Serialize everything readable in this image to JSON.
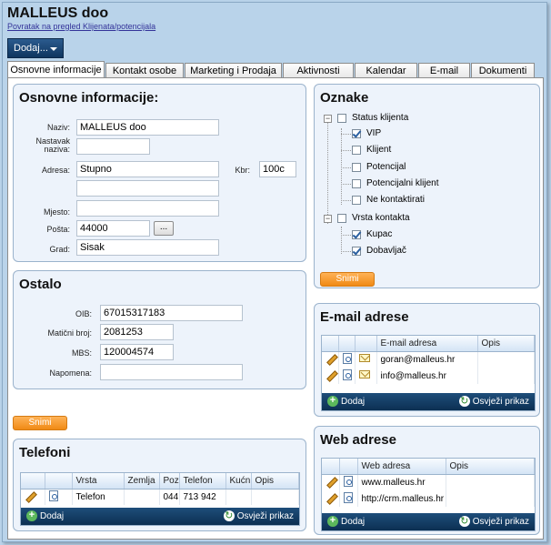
{
  "app": {
    "title": "MALLEUS doo",
    "back_link": "Povratak na pregled Klijenata/potencijala",
    "add_button": "Dodaj..."
  },
  "tabs": [
    {
      "label": "Osnovne informacije",
      "active": true
    },
    {
      "label": "Kontakt osobe"
    },
    {
      "label": "Marketing i Prodaja"
    },
    {
      "label": "Aktivnosti"
    },
    {
      "label": "Kalendar"
    },
    {
      "label": "E-mail"
    },
    {
      "label": "Dokumenti"
    }
  ],
  "basic_info": {
    "title": "Osnovne informacije:",
    "naziv_label": "Naziv:",
    "naziv_value": "MALLEUS doo",
    "nastavak_label": "Nastavak naziva:",
    "nastavak_value": "",
    "adresa_label": "Adresa:",
    "adresa_value": "Stupno",
    "adresa2_value": "",
    "kbr_label": "Kbr:",
    "kbr_value": "100c",
    "mjesto_label": "Mjesto:",
    "mjesto_value": "",
    "posta_label": "Pošta:",
    "posta_value": "44000",
    "posta_button": "...",
    "grad_label": "Grad:",
    "grad_value": "Sisak"
  },
  "other": {
    "title": "Ostalo",
    "oib_label": "OIB:",
    "oib_value": "67015317183",
    "mb_label": "Matični broj:",
    "mb_value": "2081253",
    "mbs_label": "MBS:",
    "mbs_value": "120004574",
    "napomena_label": "Napomena:",
    "napomena_value": "",
    "save_button": "Snimi"
  },
  "phones": {
    "title": "Telefoni",
    "columns": [
      "Vrsta",
      "Zemlja",
      "Poz",
      "Telefon",
      "Kućn",
      "Opis"
    ],
    "rows": [
      {
        "vrsta": "Telefon",
        "zemlja": "",
        "poz": "044",
        "telefon": "713 942",
        "kucni": "",
        "opis": ""
      }
    ],
    "add_label": "Dodaj",
    "refresh_label": "Osvježi prikaz"
  },
  "tags": {
    "title": "Oznake",
    "group1": "Status klijenta",
    "group1_items": [
      {
        "label": "VIP",
        "checked": true
      },
      {
        "label": "Klijent",
        "checked": false
      },
      {
        "label": "Potencijal",
        "checked": false
      },
      {
        "label": "Potencijalni klijent",
        "checked": false
      },
      {
        "label": "Ne kontaktirati",
        "checked": false
      }
    ],
    "group2": "Vrsta kontakta",
    "group2_items": [
      {
        "label": "Kupac",
        "checked": true
      },
      {
        "label": "Dobavljač",
        "checked": true
      }
    ],
    "save_button": "Snimi"
  },
  "emails": {
    "title": "E-mail adrese",
    "columns": [
      "E-mail adresa",
      "Opis"
    ],
    "rows": [
      {
        "address": "goran@malleus.hr",
        "opis": ""
      },
      {
        "address": "info@malleus.hr",
        "opis": ""
      }
    ],
    "add_label": "Dodaj",
    "refresh_label": "Osvježi prikaz"
  },
  "web": {
    "title": "Web adrese",
    "columns": [
      "Web adresa",
      "Opis"
    ],
    "rows": [
      {
        "address": "www.malleus.hr",
        "opis": ""
      },
      {
        "address": "http://crm.malleus.hr",
        "opis": ""
      }
    ],
    "add_label": "Dodaj",
    "refresh_label": "Osvježi prikaz"
  }
}
